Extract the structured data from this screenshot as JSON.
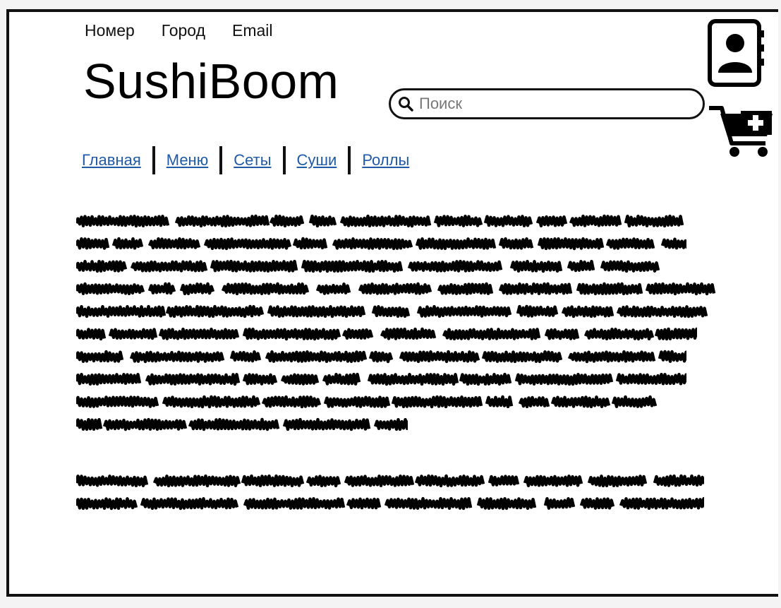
{
  "header": {
    "contacts": [
      "Номер",
      "Город",
      "Email"
    ],
    "logo": "SushiBoom",
    "search": {
      "placeholder": "Поиск"
    }
  },
  "nav": {
    "items": [
      {
        "label": "Главная"
      },
      {
        "label": "Меню"
      },
      {
        "label": "Сеты"
      },
      {
        "label": "Суши"
      },
      {
        "label": "Роллы"
      }
    ]
  },
  "icons": {
    "profile": "contact-book-icon",
    "cart": "add-to-cart-icon",
    "search": "search-icon"
  },
  "colors": {
    "link": "#1f5aa6",
    "ink": "#111111"
  }
}
